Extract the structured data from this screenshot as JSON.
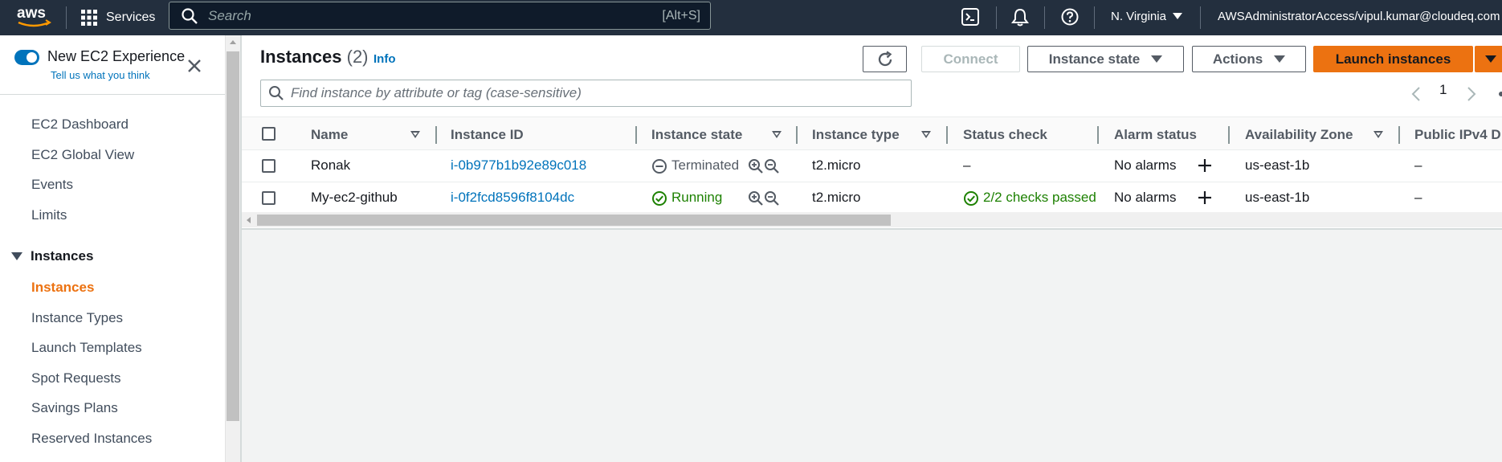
{
  "topnav": {
    "logo": "aws",
    "services_label": "Services",
    "search_placeholder": "Search",
    "search_shortcut": "[Alt+S]",
    "region": "N. Virginia",
    "account": "AWSAdministratorAccess/vipul.kumar@cloudeq.com"
  },
  "sidebar": {
    "experience_title": "New EC2 Experience",
    "experience_link": "Tell us what you think",
    "experience_enabled": true,
    "items_top": [
      "EC2 Dashboard",
      "EC2 Global View",
      "Events",
      "Limits"
    ],
    "section": "Instances",
    "items_section": [
      "Instances",
      "Instance Types",
      "Launch Templates",
      "Spot Requests",
      "Savings Plans",
      "Reserved Instances"
    ],
    "active": "Instances"
  },
  "main": {
    "title": "Instances",
    "count": "(2)",
    "info": "Info",
    "buttons": {
      "connect": "Connect",
      "instance_state": "Instance state",
      "actions": "Actions",
      "launch": "Launch instances"
    },
    "filter_placeholder": "Find instance by attribute or tag (case-sensitive)",
    "page": "1",
    "columns": [
      "Name",
      "Instance ID",
      "Instance state",
      "Instance type",
      "Status check",
      "Alarm status",
      "Availability Zone",
      "Public IPv4 D"
    ],
    "rows": [
      {
        "name": "Ronak",
        "id": "i-0b977b1b92e89c018",
        "state": "Terminated",
        "type": "t2.micro",
        "status": "–",
        "alarm": "No alarms",
        "az": "us-east-1b",
        "ipv4": "–"
      },
      {
        "name": "My-ec2-github",
        "id": "i-0f2fcd8596f8104dc",
        "state": "Running",
        "type": "t2.micro",
        "status": "2/2 checks passed",
        "alarm": "No alarms",
        "az": "us-east-1b",
        "ipv4": "–"
      }
    ]
  },
  "colors": {
    "nav_bg": "#232f3e",
    "accent_orange": "#ec7211",
    "link_blue": "#0073bb",
    "success_green": "#1d8102"
  }
}
